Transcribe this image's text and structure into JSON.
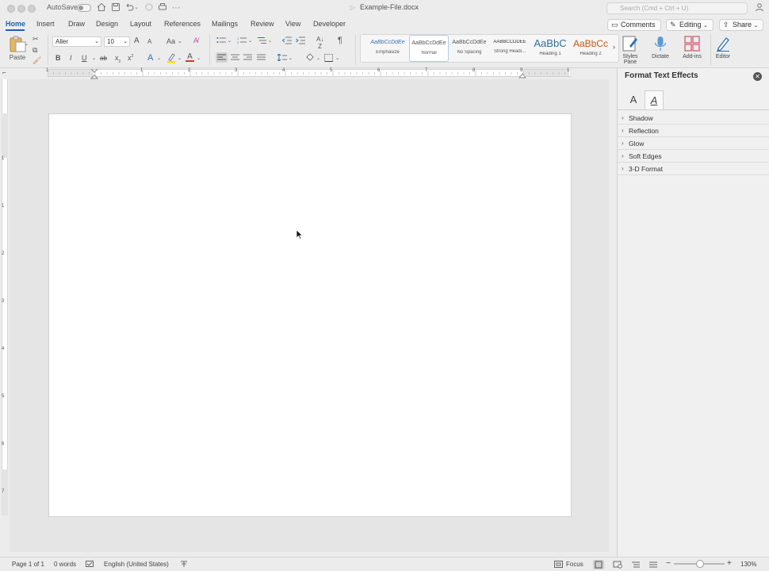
{
  "titlebar": {
    "autosave_label": "AutoSave",
    "document_title": "Example-File.docx",
    "search_placeholder": "Search (Cmd + Ctrl + U)"
  },
  "tabs": [
    "Home",
    "Insert",
    "Draw",
    "Design",
    "Layout",
    "References",
    "Mailings",
    "Review",
    "View",
    "Developer"
  ],
  "active_tab": "Home",
  "top_buttons": {
    "comments": "Comments",
    "editing": "Editing",
    "share": "Share"
  },
  "ribbon": {
    "paste_label": "Paste",
    "font_name": "Aller",
    "font_size": "10",
    "bold": "B",
    "italic": "I",
    "underline": "U",
    "strike": "ab",
    "subscript": "x",
    "superscript": "x",
    "change_case": "Aa",
    "grow": "A",
    "shrink": "A",
    "text_effects": "A",
    "font_color": "A",
    "styles": [
      {
        "preview": "AaBbCcDdEe",
        "name": "Emphasize"
      },
      {
        "preview": "AaBbCcDdEe",
        "name": "Normal"
      },
      {
        "preview": "AaBbCcDdEe",
        "name": "No Spacing"
      },
      {
        "preview": "AABBCCDDEE",
        "name": "Strong Headi..."
      },
      {
        "preview": "AaBbC",
        "name": "Heading 1"
      },
      {
        "preview": "AaBbCc",
        "name": "Heading 2"
      }
    ],
    "styles_pane": "Styles Pane",
    "dictate": "Dictate",
    "addins": "Add-ins",
    "editor": "Editor"
  },
  "ruler": {
    "h_numbers": [
      "1",
      "1",
      "2",
      "3",
      "4",
      "5",
      "6",
      "7",
      "8",
      "9",
      "1"
    ],
    "v_numbers": [
      "1",
      "1",
      "2",
      "3",
      "4",
      "5",
      "6",
      "7"
    ]
  },
  "pane": {
    "title": "Format Text Effects",
    "tab_text_fill": "A",
    "tab_text_effects": "A",
    "sections": [
      "Shadow",
      "Reflection",
      "Glow",
      "Soft Edges",
      "3-D Format"
    ]
  },
  "statusbar": {
    "page": "Page 1 of 1",
    "words": "0 words",
    "language": "English (United States)",
    "focus": "Focus",
    "zoom": "130%"
  },
  "colors": {
    "accent": "#1d5fb0",
    "heading1": "#2f6f9f",
    "heading2": "#c55a11",
    "highlight": "#f7e200",
    "font_color": "#d9342b"
  }
}
